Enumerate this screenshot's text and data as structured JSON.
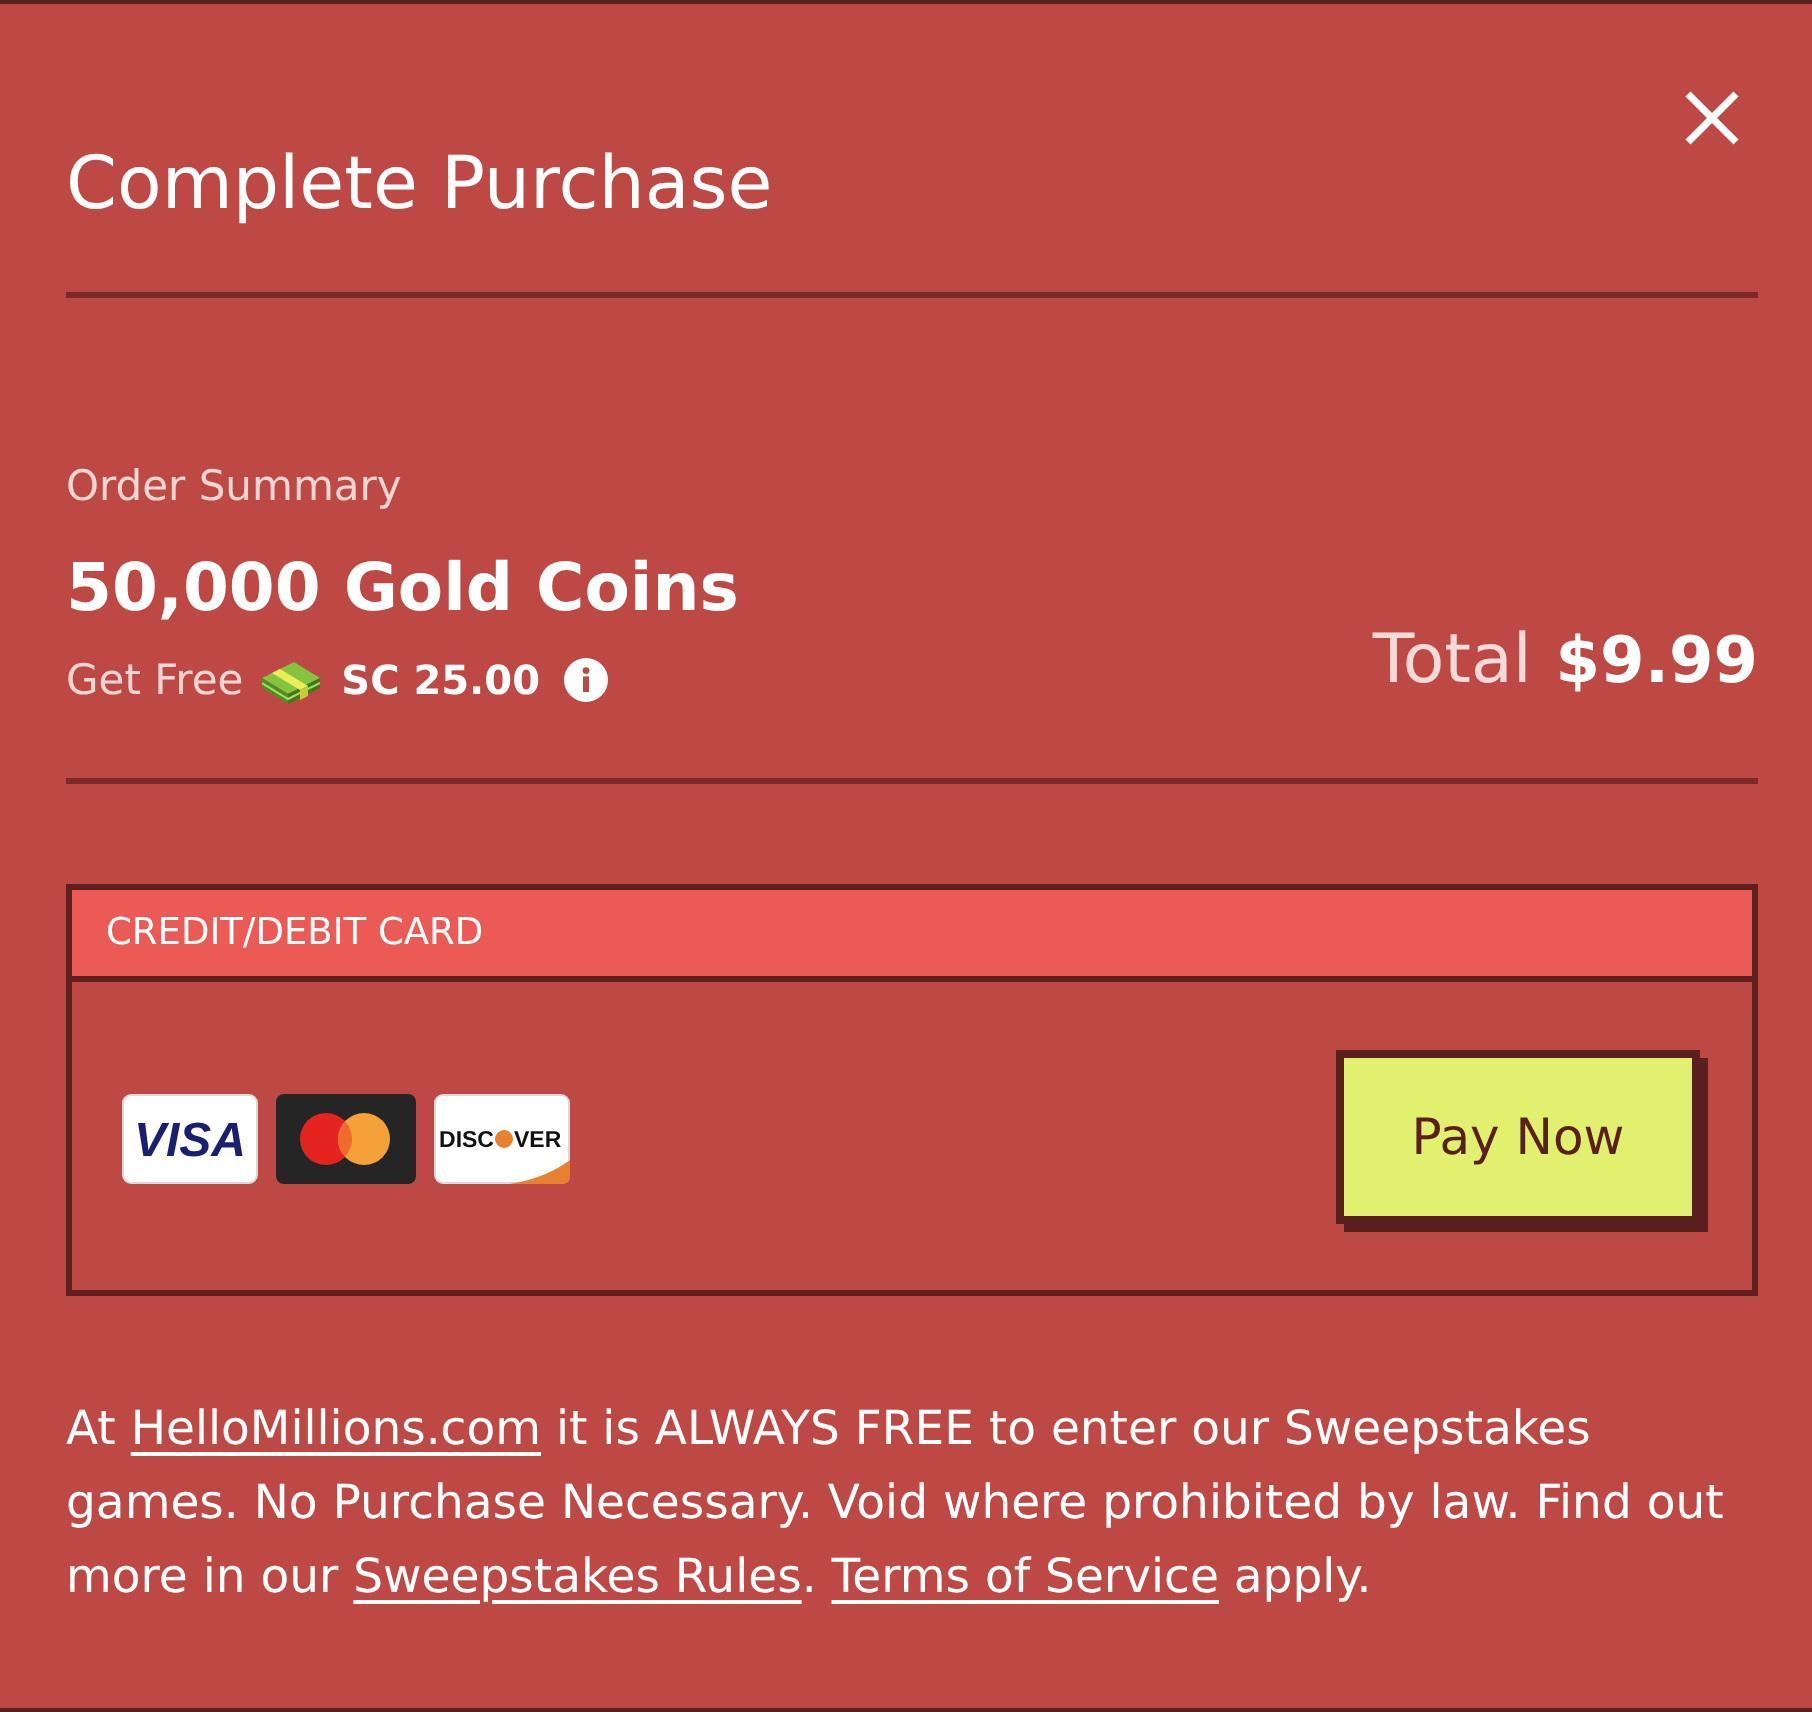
{
  "dialog": {
    "title": "Complete Purchase"
  },
  "order_summary": {
    "label": "Order Summary",
    "product": "50,000 Gold Coins",
    "bonus": {
      "prefix": "Get Free",
      "amount": "SC 25.00"
    },
    "total": {
      "label": "Total",
      "amount": "$9.99"
    }
  },
  "payment": {
    "method": "CREDIT/DEBIT CARD",
    "cards": [
      {
        "kind": "visa",
        "label_parts": [
          "VISA"
        ]
      },
      {
        "kind": "mastercard"
      },
      {
        "kind": "discover",
        "label_parts": [
          "DISC",
          "VER"
        ]
      }
    ],
    "button": "Pay Now"
  },
  "disclaimer": [
    {
      "kind": "text",
      "text": "At "
    },
    {
      "kind": "link",
      "text": "HelloMillions.com"
    },
    {
      "kind": "text",
      "text": " it is ALWAYS FREE to enter our Sweepstakes games. No Purchase Necessary. Void where prohibited by law. Find out more in our "
    },
    {
      "kind": "link",
      "text": "Sweepstakes Rules"
    },
    {
      "kind": "text",
      "text": ". "
    },
    {
      "kind": "link",
      "text": "Terms of Service"
    },
    {
      "kind": "text",
      "text": " apply."
    }
  ]
}
